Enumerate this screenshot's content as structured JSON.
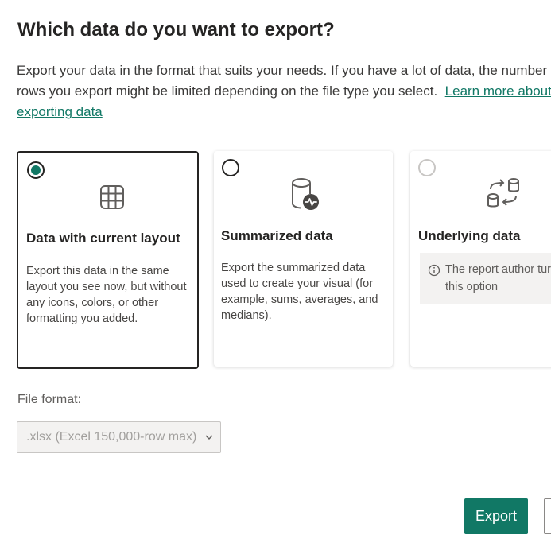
{
  "dialog": {
    "title": "Which data do you want to export?",
    "description": "Export your data in the format that suits your needs. If you have a lot of data, the number of rows you export might be limited depending on the file type you select.",
    "learn_more_link": "Learn more about exporting data"
  },
  "options": [
    {
      "title": "Data with current layout",
      "description": "Export this data in the same layout you see now, but without any icons, colors, or other formatting you added.",
      "icon": "table-grid-icon",
      "selected": true
    },
    {
      "title": "Summarized data",
      "description": "Export the summarized data used to create your visual (for example, sums, averages, and medians).",
      "icon": "database-activity-icon",
      "selected": false
    },
    {
      "title": "Underlying data",
      "info": "The report author turned off this option",
      "icon": "database-exchange-icon",
      "selected": false,
      "disabled": true
    }
  ],
  "file_format": {
    "label": "File format:",
    "value": ".xlsx (Excel 150,000-row max)"
  },
  "buttons": {
    "export_label": "Export",
    "cancel_label": ""
  },
  "colors": {
    "accent": "#117865",
    "text": "#252423",
    "disabled": "#a19f9d"
  }
}
